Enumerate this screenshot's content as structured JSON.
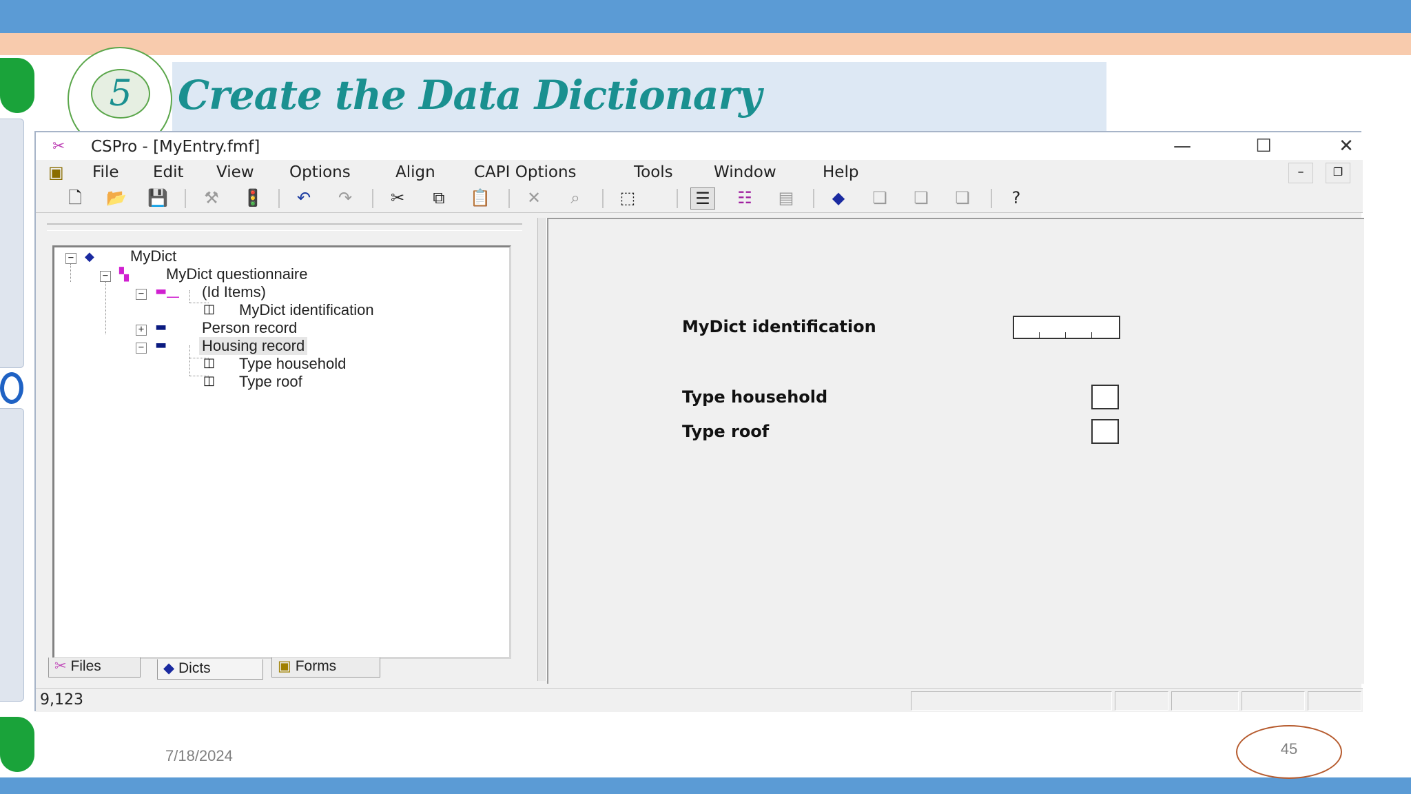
{
  "slide": {
    "step_number": "5",
    "title": "Create the Data Dictionary",
    "date": "7/18/2024",
    "page_number": "45"
  },
  "window": {
    "title": "CSPro - [MyEntry.fmf]",
    "controls": {
      "minimize": "—",
      "maximize": "☐",
      "close": "✕"
    },
    "menu": [
      "File",
      "Edit",
      "View",
      "Options",
      "Align",
      "CAPI Options",
      "Tools",
      "Window",
      "Help"
    ],
    "toolbar_icons": [
      "new-icon",
      "open-icon",
      "save-icon",
      "generate-icon",
      "run-icon",
      "undo-icon",
      "redo-icon",
      "cut-icon",
      "copy-icon",
      "paste-icon",
      "delete-icon",
      "find-icon",
      "select-icon",
      "view-form-icon",
      "view-logic-icon",
      "view-grid-icon",
      "dictionary-icon",
      "form1-icon",
      "form2-icon",
      "form3-icon",
      "help-icon"
    ],
    "status": "9,123"
  },
  "tree": {
    "root": "MyDict",
    "questionnaire": "MyDict questionnaire",
    "id_items": "(Id Items)",
    "id_child": "MyDict identification",
    "person": "Person record",
    "housing": "Housing record",
    "housing_children": [
      "Type household",
      "Type roof"
    ]
  },
  "tabs": [
    "Files",
    "Dicts",
    "Forms"
  ],
  "form": {
    "id_label": "MyDict identification",
    "fields": [
      "Type household",
      "Type roof"
    ]
  },
  "colors": {
    "accent_teal": "#1a9090",
    "bar_blue": "#5b9bd5",
    "bar_peach": "#f8cbad"
  }
}
